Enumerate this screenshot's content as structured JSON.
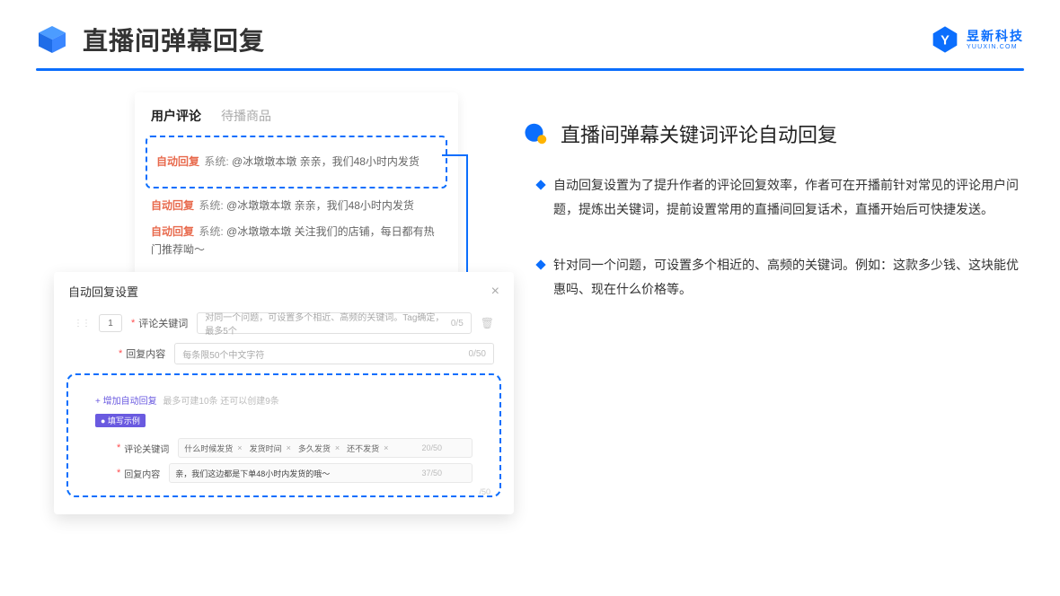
{
  "header": {
    "page_title": "直播间弹幕回复",
    "brand_cn": "昱新科技",
    "brand_en": "YUUXIN.COM"
  },
  "comments": {
    "tab_active": "用户评论",
    "tab_inactive": "待播商品",
    "rows": [
      {
        "auto": "自动回复",
        "sys": "系统:",
        "text": "@冰墩墩本墩 亲亲，我们48小时内发货"
      },
      {
        "auto": "自动回复",
        "sys": "系统:",
        "text": "@冰墩墩本墩 亲亲，我们48小时内发货"
      },
      {
        "auto": "自动回复",
        "sys": "系统:",
        "text": "@冰墩墩本墩 关注我们的店铺，每日都有热门推荐呦～"
      }
    ]
  },
  "dialog": {
    "title": "自动回复设置",
    "seq": "1",
    "keyword_label": "评论关键词",
    "keyword_placeholder": "对同一个问题，可设置多个相近、高频的关键词。Tag确定，最多5个",
    "keyword_count": "0/5",
    "content_label": "回复内容",
    "content_placeholder": "每条限50个中文字符",
    "content_count": "0/50",
    "add_text": "+ 增加自动回复",
    "add_hint": "最多可建10条 还可以创建9条",
    "example_badge": "● 填写示例",
    "example_keyword_label": "评论关键词",
    "example_tags": [
      "什么时候发货",
      "发货时间",
      "多久发货",
      "还不发货"
    ],
    "example_kw_count": "20/50",
    "example_content_label": "回复内容",
    "example_content_value": "亲，我们这边都是下单48小时内发货的哦～",
    "example_content_count": "37/50",
    "ghost_count": "/50"
  },
  "section": {
    "title": "直播间弹幕关键词评论自动回复",
    "bullets": [
      "自动回复设置为了提升作者的评论回复效率，作者可在开播前针对常见的评论用户问题，提炼出关键词，提前设置常用的直播间回复话术，直播开始后可快捷发送。",
      "针对同一个问题，可设置多个相近的、高频的关键词。例如：这款多少钱、这块能优惠吗、现在什么价格等。"
    ]
  }
}
